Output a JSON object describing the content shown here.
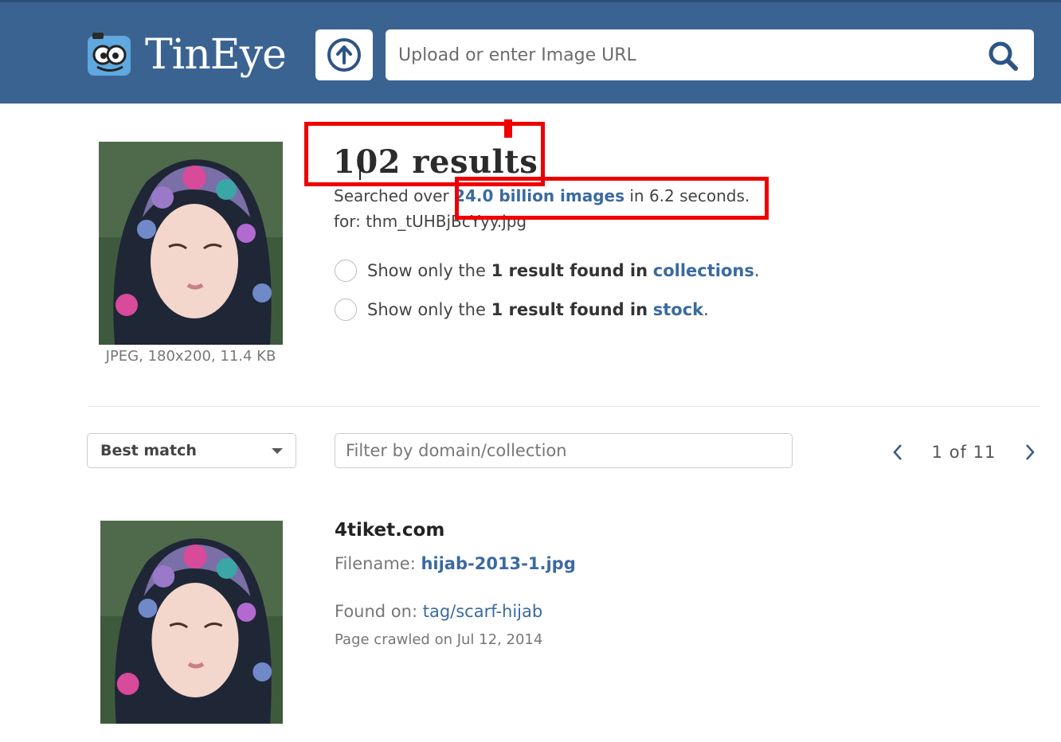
{
  "app": {
    "name": "TinEye"
  },
  "search": {
    "placeholder": "Upload or enter Image URL"
  },
  "query": {
    "results_count": "102 results",
    "searched_prefix": "Searched over ",
    "images_link": "24.0 billion images",
    "searched_suffix": " in 6.2 seconds.",
    "for_line": "for: thm_tUHBjBcYyy.jpg",
    "image_meta": "JPEG, 180x200, 11.4 KB"
  },
  "filters_options": [
    {
      "prefix": "Show only the ",
      "strong": "1 result found in ",
      "link": "collections",
      "suffix": "."
    },
    {
      "prefix": "Show only the ",
      "strong": "1 result found in ",
      "link": "stock",
      "suffix": "."
    }
  ],
  "controls": {
    "sort_selected": "Best match",
    "filter_placeholder": "Filter by domain/collection",
    "pager": "1  of  11"
  },
  "result": {
    "domain": "4tiket.com",
    "filename_label": "Filename: ",
    "filename": "hijab-2013-1.jpg",
    "found_label": "Found on: ",
    "found_link": "tag/scarf-hijab",
    "crawled": "Page crawled on Jul 12, 2014"
  },
  "colors": {
    "header_bg": "#3b6391",
    "link": "#3a6aa0",
    "annotation": "#ee0000"
  },
  "icons": {
    "upload": "upload-arrow-icon",
    "search": "search-icon",
    "prev": "chevron-left-icon",
    "next": "chevron-right-icon",
    "sort_caret": "caret-down-icon"
  }
}
